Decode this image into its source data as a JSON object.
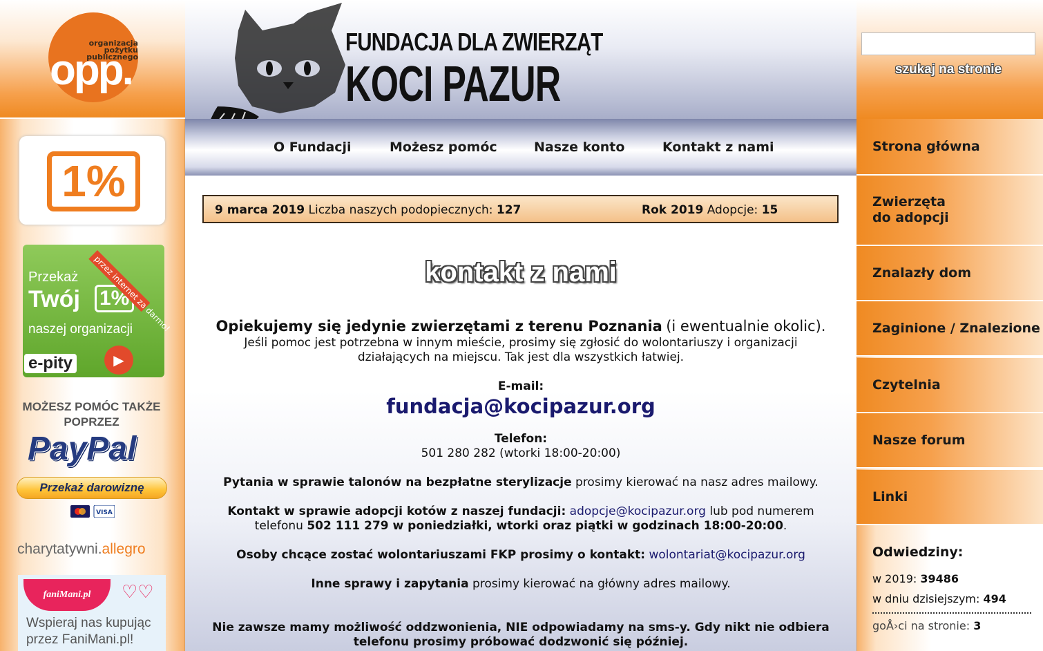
{
  "left": {
    "opp_top": "organizacja pożytku publicznego",
    "opp_logo": "opp.",
    "one_percent": "1%",
    "epity": {
      "line1": "Przekaż",
      "line2": "Twój",
      "pct": "1%",
      "line3": "naszej organizacji",
      "ribbon": "przez internet za darmo!",
      "brand": "e-pity"
    },
    "paypal_text": "MOŻESZ POMÓC TAKŻE POPRZEZ",
    "paypal_logo": "PayPal",
    "paypal_button": "Przekaż darowiznę",
    "allegro_prefix": "charytatywni.",
    "allegro_brand": "allegro",
    "fanimani_brand": "faniMani.pl",
    "fanimani_text": "Wspieraj nas kupując przez FaniMani.pl!"
  },
  "header": {
    "title_line1": "FUNDACJA DLA ZWIERZĄT",
    "title_line2": "KOCI PAZUR"
  },
  "nav": [
    "O Fundacji",
    "Możesz pomóc",
    "Nasze konto",
    "Kontakt z nami"
  ],
  "search": {
    "button": "szukaj na stronie",
    "value": ""
  },
  "infobar": {
    "date": "9 marca 2019",
    "count_label": "Liczba naszych podopiecznych:",
    "count": "127",
    "year": "Rok 2019",
    "adopt_label": "Adopcje:",
    "adopt": "15"
  },
  "content": {
    "title": "kontakt z nami",
    "intro_bold": "Opiekujemy się jedynie zwierzętami z terenu Poznania",
    "intro_rest": "(i ewentualnie okolic).",
    "intro_2": "Jeśli pomoc jest potrzebna w innym mieście, prosimy się zgłosić do wolontariuszy i organizacji",
    "intro_3": "działających na miejscu. Tak jest dla wszystkich łatwiej.",
    "email_label": "E-mail:",
    "email": "fundacja@kocipazur.org",
    "phone_label": "Telefon:",
    "phone": "501 280 282 (wtorki 18:00-20:00)",
    "steril_bold": "Pytania w sprawie talonów na bezpłatne sterylizacje",
    "steril_rest": "prosimy kierować na nasz adres mailowy.",
    "adopt_bold": "Kontakt w sprawie adopcji kotów z naszej fundacji:",
    "adopt_email": "adopcje@kocipazur.org",
    "adopt_mid": "lub pod numerem",
    "adopt_line2a": "telefonu",
    "adopt_line2b": "502 111 279 w poniedziałki, wtorki oraz piątki w godzinach 18:00-20:00",
    "adopt_line2c": ".",
    "vol_bold": "Osoby chcące zostać wolontariuszami FKP prosimy o kontakt:",
    "vol_email": "wolontariat@kocipazur.org",
    "other_bold": "Inne sprawy i zapytania",
    "other_rest": "prosimy kierować na główny adres mailowy.",
    "notice_1": "Nie zawsze mamy możliwość oddzwonienia, NIE odpowiadamy na sms-y. Gdy nikt nie odbiera",
    "notice_2": "telefonu prosimy próbować dodzwonić się później."
  },
  "menu": [
    "Strona główna",
    "Zwierzęta\ndo adopcji",
    "Znalazły dom",
    "Zaginione / Znalezione",
    "Czytelnia",
    "Nasze forum",
    "Linki"
  ],
  "visits": {
    "title": "Odwiedziny:",
    "year_label": "w 2019:",
    "year_value": "39486",
    "today_label": "w dniu dzisiejszym:",
    "today_value": "494",
    "online_label": "goÅ›ci na stronie:",
    "online_value": "3"
  },
  "colors": {
    "orange": "#ef8a22",
    "navy": "#1a1a6e",
    "header_blue": "#a8aec9"
  }
}
